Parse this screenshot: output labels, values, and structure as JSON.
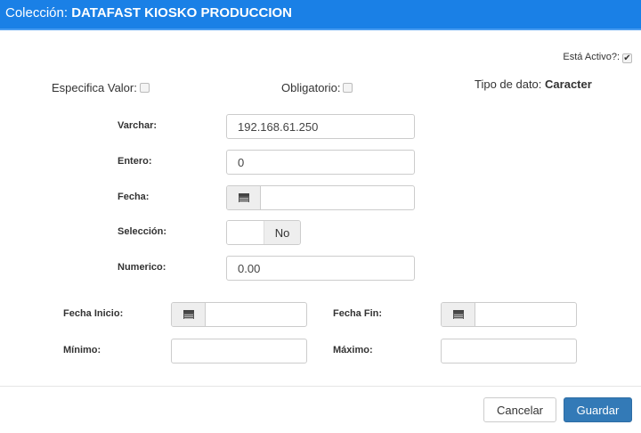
{
  "header": {
    "prefix": "Colección:",
    "title": "DATAFAST KIOSKO PRODUCCION"
  },
  "flags": {
    "activo_label": "Está Activo?:",
    "activo_checked": true,
    "especifica_label": "Especifica Valor:",
    "especifica_checked": false,
    "obligatorio_label": "Obligatorio:",
    "obligatorio_checked": false,
    "tipo_label": "Tipo de dato:",
    "tipo_value": "Caracter"
  },
  "fields": {
    "varchar_label": "Varchar:",
    "varchar_value": "192.168.61.250",
    "entero_label": "Entero:",
    "entero_value": "0",
    "fecha_label": "Fecha:",
    "fecha_value": "",
    "seleccion_label": "Selección:",
    "seleccion_value": "No",
    "numerico_label": "Numerico:",
    "numerico_value": "0.00",
    "fecha_inicio_label": "Fecha Inicio:",
    "fecha_fin_label": "Fecha Fin:",
    "minimo_label": "Mínimo:",
    "maximo_label": "Máximo:"
  },
  "footer": {
    "cancel": "Cancelar",
    "save": "Guardar"
  },
  "colors": {
    "header": "#1a80e6",
    "primary": "#337ab7"
  }
}
